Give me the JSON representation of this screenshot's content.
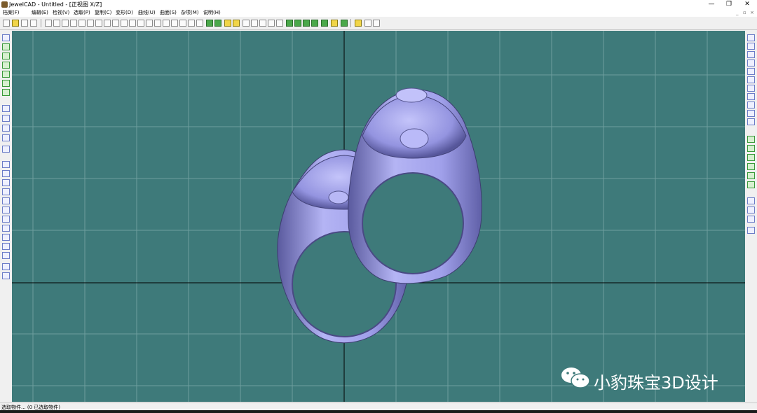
{
  "window": {
    "title": "JewelCAD - Untitled - [正视图 X/Z]",
    "minimize": "—",
    "restore": "❐",
    "close": "✕"
  },
  "menu": [
    "档案(F)",
    "编辑(E)",
    "检视(V)",
    "选取(P)",
    "复制(C)",
    "变形(D)",
    "曲线(U)",
    "曲面(S)",
    "杂项(M)",
    "说明(H)"
  ],
  "mdi_controls": {
    "minimize": "_",
    "restore": "▫",
    "close": "×"
  },
  "viewport": {
    "view_name": "正视图 X/Z",
    "background_color": "#3e7a7a",
    "grid_color": "#6e9e9e",
    "axis_color": "#000000",
    "model_color": "#a8a8f0"
  },
  "status": {
    "text": "选取物件... (0 已选取物件)"
  },
  "watermark": {
    "text": "小豹珠宝3D设计",
    "icon": "wechat-icon"
  }
}
